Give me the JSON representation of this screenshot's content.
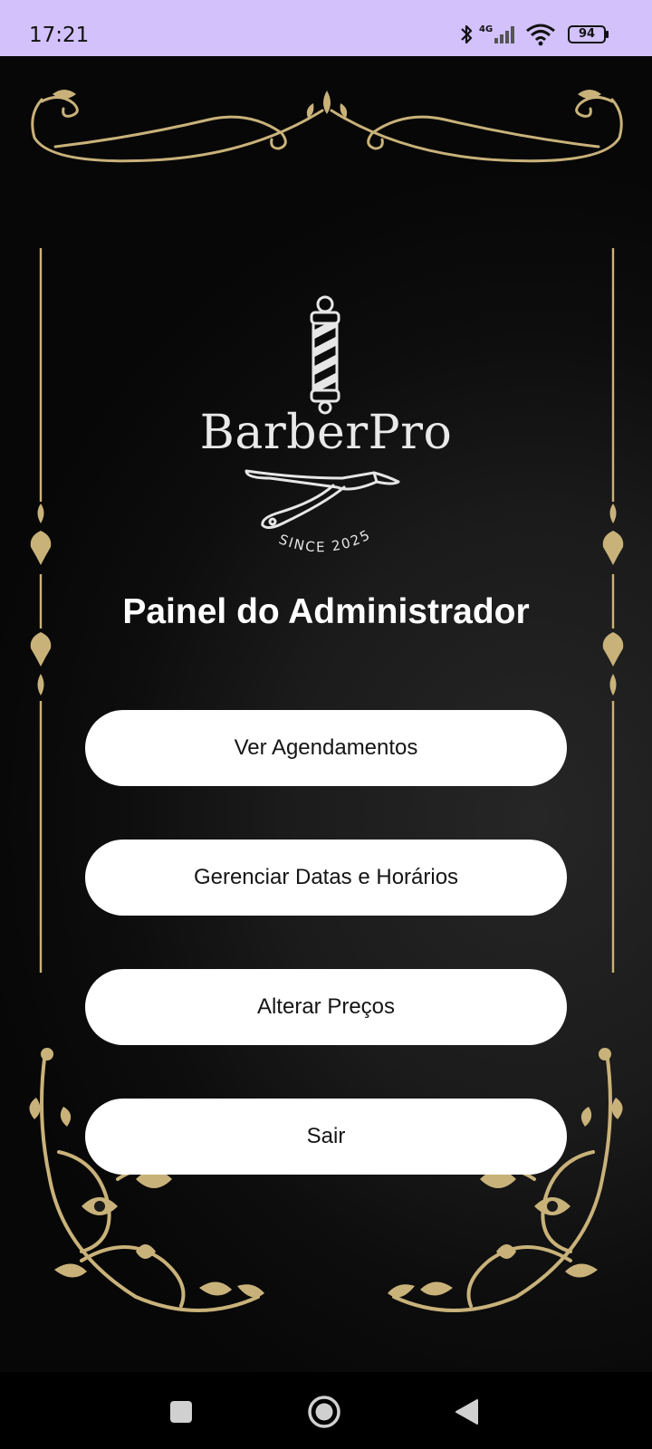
{
  "status_bar": {
    "time": "17:21",
    "network": "4G",
    "battery": "94",
    "icons": [
      "bluetooth-icon",
      "cell-signal-icon",
      "wifi-icon",
      "battery-icon"
    ]
  },
  "app": {
    "brand": "BarberPro",
    "since": "SINCE 2025",
    "title": "Painel do Administrador"
  },
  "menu": {
    "view_appointments": "Ver Agendamentos",
    "manage_dates": "Gerenciar Datas e Horários",
    "change_prices": "Alterar Preços",
    "logout": "Sair"
  },
  "nav_bar": {
    "icons": [
      "recents-square-icon",
      "home-circle-icon",
      "back-triangle-icon"
    ]
  },
  "colors": {
    "status_bar_bg": "#d2c1fb",
    "background": "#111111",
    "ornament_gold": "#c9b27a",
    "button_bg": "#ffffff",
    "button_text": "#151515"
  }
}
